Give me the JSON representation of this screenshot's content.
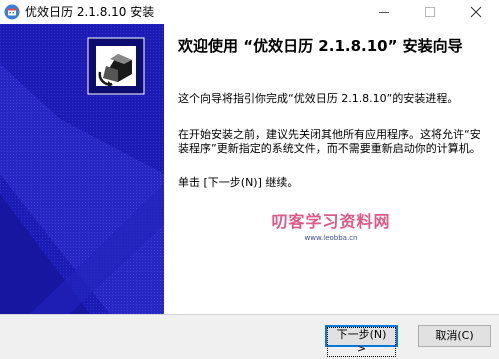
{
  "window": {
    "title": "优效日历 2.1.8.10 安装",
    "minimize_glyph": "—",
    "maximize_glyph": "☐",
    "close_glyph": "✕"
  },
  "content": {
    "heading": "欢迎使用 “优效日历 2.1.8.10” 安装向导",
    "paragraph1": "这个向导将指引你完成“优效日历 2.1.8.10”的安装进程。",
    "paragraph2": "在开始安装之前，建议先关闭其他所有应用程序。这将允许“安装程序”更新指定的系统文件，而不需要重新启动你的计算机。",
    "paragraph3": "单击 [下一步(N)] 继续。"
  },
  "watermark": {
    "text": "叨客学习资料网",
    "url": "www.leobba.cn"
  },
  "buttons": {
    "next": "下一步(N) >",
    "cancel": "取消(C)"
  },
  "icons": {
    "app": "calendar-app-icon",
    "installer": "installer-box-icon"
  },
  "colors": {
    "sidebar": "#1a1ab0",
    "button_focus": "#0078d7",
    "watermark_text": "#e05a88",
    "watermark_url": "#3a4fb5"
  }
}
